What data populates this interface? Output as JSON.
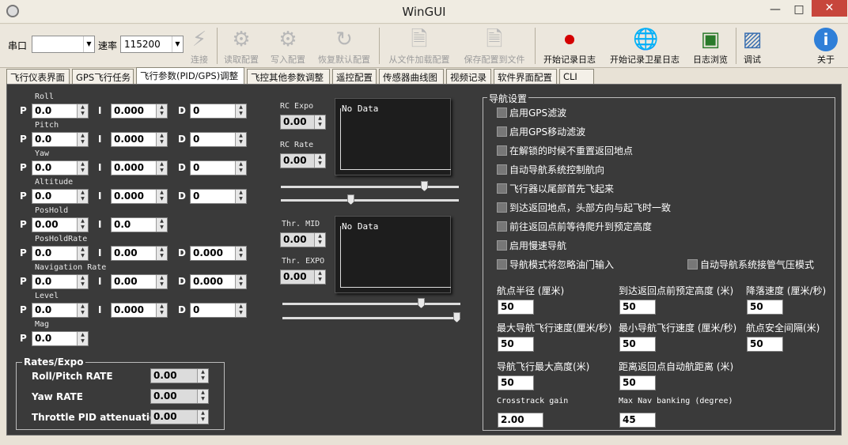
{
  "window": {
    "title": "WinGUI",
    "minimize": "—",
    "maximize": "□",
    "close": "✕"
  },
  "toolbar": {
    "serial_label": "串口",
    "serial_value": "",
    "baud_label": "速率",
    "baud_value": "115200",
    "buttons": [
      {
        "label": "连接",
        "icon": "plug-icon"
      },
      {
        "label": "读取配置",
        "icon": "gear-icon"
      },
      {
        "label": "写入配置",
        "icon": "gear-icon"
      },
      {
        "label": "恢复默认配置",
        "icon": "refresh-icon"
      },
      {
        "label": "从文件加载配置",
        "icon": "file-icon"
      },
      {
        "label": "保存配置到文件",
        "icon": "file-icon"
      },
      {
        "label": "开始记录日志",
        "icon": "record-icon"
      },
      {
        "label": "开始记录卫星日志",
        "icon": "globe-icon"
      },
      {
        "label": "日志浏览",
        "icon": "monitor-icon"
      },
      {
        "label": "调试",
        "icon": "image-icon"
      },
      {
        "label": "关于",
        "icon": "info-icon"
      }
    ]
  },
  "tabs": [
    "飞行仪表界面",
    "GPS飞行任务",
    "飞行参数(PID/GPS)调整",
    "飞控其他参数调整",
    "遥控配置",
    "传感器曲线图",
    "视频记录",
    "软件界面配置",
    "CLI"
  ],
  "pid": {
    "p": "P",
    "i": "I",
    "d": "D",
    "rows": [
      {
        "name": "Roll",
        "p": "0.0",
        "i": "0.000",
        "d": "0"
      },
      {
        "name": "Pitch",
        "p": "0.0",
        "i": "0.000",
        "d": "0"
      },
      {
        "name": "Yaw",
        "p": "0.0",
        "i": "0.000",
        "d": "0"
      },
      {
        "name": "Altitude",
        "p": "0.0",
        "i": "0.000",
        "d": "0"
      },
      {
        "name": "PosHold",
        "p": "0.00",
        "i": "0.0",
        "d": ""
      },
      {
        "name": "PosHoldRate",
        "p": "0.0",
        "i": "0.00",
        "d": "0.000"
      },
      {
        "name": "Navigation Rate",
        "p": "0.0",
        "i": "0.00",
        "d": "0.000"
      },
      {
        "name": "Level",
        "p": "0.0",
        "i": "0.000",
        "d": "0"
      },
      {
        "name": "Mag",
        "p": "0.0",
        "i": "",
        "d": ""
      }
    ]
  },
  "rates": {
    "title": "Rates/Expo",
    "roll_pitch_label": "Roll/Pitch RATE",
    "roll_pitch": "0.00",
    "yaw_label": "Yaw RATE",
    "yaw": "0.00",
    "tpa_label": "Throttle PID attenuation",
    "tpa": "0.00"
  },
  "rc": {
    "expo_label": "RC Expo",
    "expo": "0.00",
    "rate_label": "RC Rate",
    "rate": "0.00",
    "graph1": "No Data",
    "thr_mid_label": "Thr. MID",
    "thr_mid": "0.00",
    "thr_expo_label": "Thr. EXPO",
    "thr_expo": "0.00",
    "graph2": "No Data",
    "slider1_a": 0.82,
    "slider1_b": 0.39,
    "slider2_a": 0.79,
    "slider2_b": 1.0
  },
  "nav": {
    "title": "导航设置",
    "checks": [
      "启用GPS滤波",
      "启用GPS移动滤波",
      "在解锁的时候不重置返回地点",
      "自动导航系统控制航向",
      "飞行器以尾部首先飞起来",
      "到达返回地点，头部方向与起飞时一致",
      "前往返回点前等待爬升到预定高度",
      "启用慢速导航",
      "导航模式将忽略油门输入"
    ],
    "check_extra": "自动导航系统接管气压模式",
    "fields": [
      {
        "label": "航点半径 (厘米)",
        "value": "50"
      },
      {
        "label": "到达返回点前预定高度 (米)",
        "value": "50"
      },
      {
        "label": "降落速度 (厘米/秒)",
        "value": "50"
      },
      {
        "label": "最大导航飞行速度(厘米/秒)",
        "value": "50"
      },
      {
        "label": "最小导航飞行速度 (厘米/秒)",
        "value": "50"
      },
      {
        "label": "航点安全间隔(米)",
        "value": "50"
      },
      {
        "label": "导航飞行最大高度(米)",
        "value": "50"
      },
      {
        "label": "距离返回点自动航距离 (米)",
        "value": "50"
      },
      {
        "label": "Crosstrack gain",
        "value": "2.00"
      },
      {
        "label": "Max Nav banking (degree)",
        "value": "45"
      }
    ]
  }
}
